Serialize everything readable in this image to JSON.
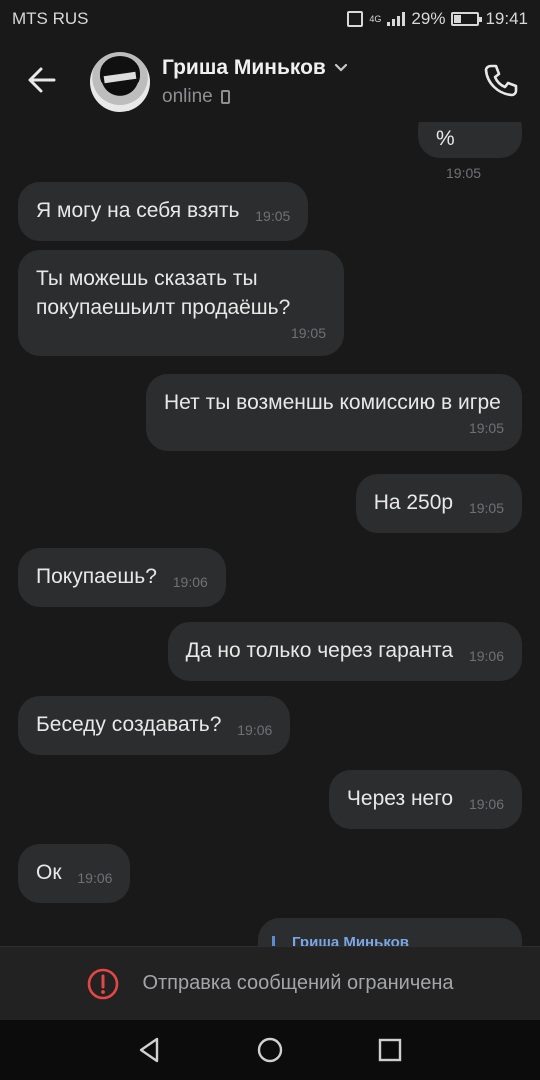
{
  "status": {
    "carrier": "MTS RUS",
    "network": "4G",
    "battery": "29%",
    "time": "19:41"
  },
  "header": {
    "contact_name": "Гриша Миньков",
    "presence": "online"
  },
  "messages": [
    {
      "text": "%",
      "time": "19:05",
      "dir": "out"
    },
    {
      "text": "Я могу на себя взять",
      "time": "19:05",
      "dir": "in"
    },
    {
      "text": "Ты можешь сказать ты покупаешьилт продаёшь?",
      "time": "19:05",
      "dir": "in"
    },
    {
      "text": "Нет ты возменшь комиссию в игре",
      "time": "19:05",
      "dir": "out"
    },
    {
      "text": "На 250р",
      "time": "19:05",
      "dir": "out"
    },
    {
      "text": "Покупаешь?",
      "time": "19:06",
      "dir": "in"
    },
    {
      "text": "Да но только через гаранта",
      "time": "19:06",
      "dir": "out"
    },
    {
      "text": "Беседу создавать?",
      "time": "19:06",
      "dir": "in"
    },
    {
      "text": "Через него",
      "time": "19:06",
      "dir": "out"
    },
    {
      "text": "Ок",
      "time": "19:06",
      "dir": "in"
    }
  ],
  "forwarded": {
    "author": "Гриша Миньков"
  },
  "footer": {
    "restriction_text": "Отправка сообщений ограничена"
  },
  "colors": {
    "background": "#19191a",
    "bubble": "#2c2d2e",
    "accent_link": "#7aa6e6",
    "warning": "#e64646"
  }
}
